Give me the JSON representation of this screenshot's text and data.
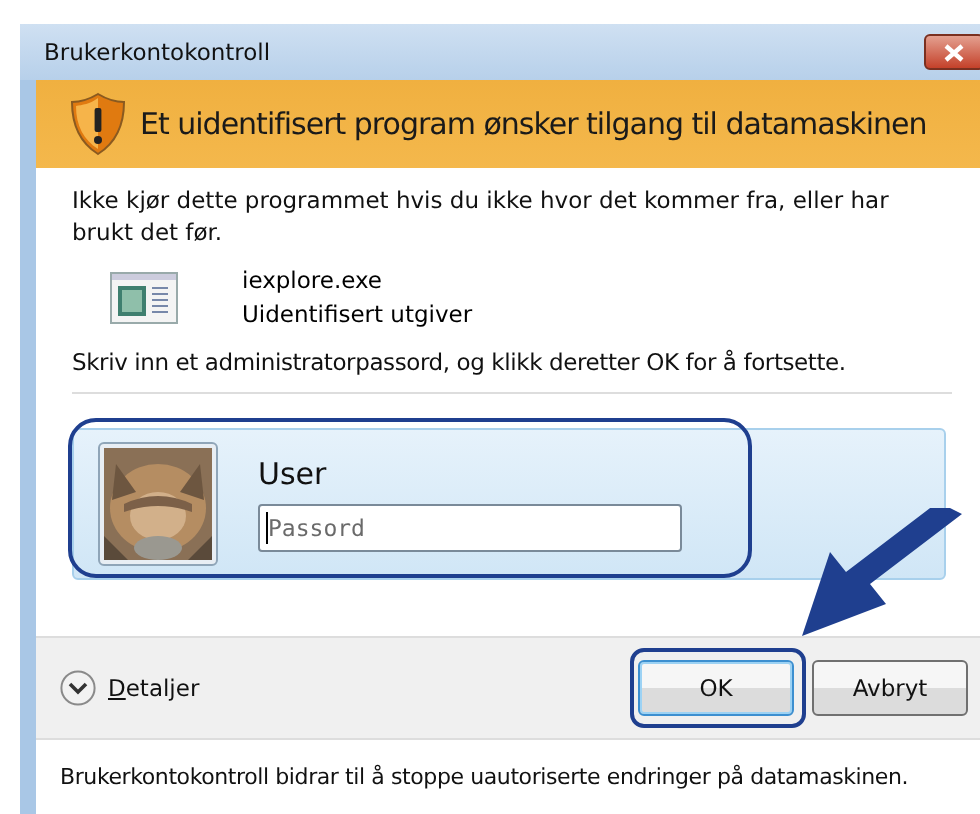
{
  "window": {
    "title": "Brukerkontokontroll"
  },
  "banner": {
    "heading": "Et uidentifisert program ønsker tilgang til datamaskinen"
  },
  "warning": "Ikke kjør dette programmet hvis du ikke hvor det kommer fra, eller har brukt det før.",
  "program": {
    "name": "iexplore.exe",
    "publisher": "Uidentifisert utgiver"
  },
  "instruction": "Skriv inn et administratorpassord, og klikk deretter OK for å fortsette.",
  "account": {
    "user": "User",
    "highlighted": true,
    "password": {
      "placeholder": "Passord",
      "focused": true
    }
  },
  "details": {
    "label": "Detaljer",
    "expanded": false
  },
  "buttons": [
    {
      "label": "OK",
      "default": true,
      "highlighted": true
    },
    {
      "label": "Avbryt",
      "default": false,
      "highlighted": false
    }
  ],
  "footer": "Brukerkontokontroll bidrar til å stoppe uautoriserte endringer på datamaskinen."
}
